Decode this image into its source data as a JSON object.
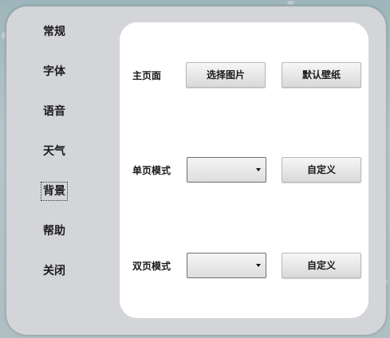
{
  "sidebar": {
    "items": [
      {
        "key": "general",
        "label": "常规"
      },
      {
        "key": "font",
        "label": "字体"
      },
      {
        "key": "voice",
        "label": "语音"
      },
      {
        "key": "weather",
        "label": "天气"
      },
      {
        "key": "background",
        "label": "背景"
      },
      {
        "key": "help",
        "label": "帮助"
      },
      {
        "key": "close",
        "label": "关闭"
      }
    ],
    "active": "背景"
  },
  "background_settings": {
    "main_page": {
      "label": "主页面",
      "select_image_label": "选择图片",
      "default_wallpaper_label": "默认壁纸"
    },
    "single_page_mode": {
      "label": "单页模式",
      "dropdown_value": "",
      "custom_label": "自定义"
    },
    "double_page_mode": {
      "label": "双页模式",
      "dropdown_value": "",
      "custom_label": "自定义"
    }
  }
}
